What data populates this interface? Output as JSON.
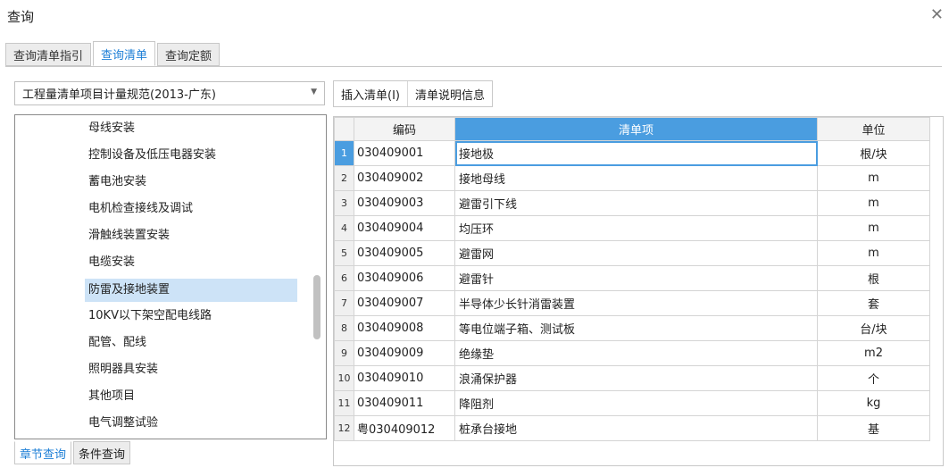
{
  "window": {
    "title": "查询",
    "close_glyph": "✕"
  },
  "tabs": [
    {
      "label": "查询清单指引"
    },
    {
      "label": "查询清单"
    },
    {
      "label": "查询定额"
    }
  ],
  "standard_select": {
    "value": "工程量清单项目计量规范(2013-广东)"
  },
  "toolbar": {
    "insert_label": "插入清单(I)",
    "info_label": "清单说明信息"
  },
  "tree": {
    "items": [
      {
        "label": "母线安装"
      },
      {
        "label": "控制设备及低压电器安装"
      },
      {
        "label": "蓄电池安装"
      },
      {
        "label": "电机检查接线及调试"
      },
      {
        "label": "滑触线装置安装"
      },
      {
        "label": "电缆安装"
      },
      {
        "label": "防雷及接地装置"
      },
      {
        "label": "10KV以下架空配电线路"
      },
      {
        "label": "配管、配线"
      },
      {
        "label": "照明器具安装"
      },
      {
        "label": "其他项目"
      },
      {
        "label": "电气调整试验"
      }
    ],
    "selected_index": 6
  },
  "bottom_tabs": [
    {
      "label": "章节查询"
    },
    {
      "label": "条件查询"
    }
  ],
  "grid": {
    "headers": {
      "code": "编码",
      "name": "清单项",
      "unit": "单位"
    },
    "rows": [
      {
        "no": "1",
        "code": "030409001",
        "name": "接地极",
        "unit": "根/块"
      },
      {
        "no": "2",
        "code": "030409002",
        "name": "接地母线",
        "unit": "m"
      },
      {
        "no": "3",
        "code": "030409003",
        "name": "避雷引下线",
        "unit": "m"
      },
      {
        "no": "4",
        "code": "030409004",
        "name": "均压环",
        "unit": "m"
      },
      {
        "no": "5",
        "code": "030409005",
        "name": "避雷网",
        "unit": "m"
      },
      {
        "no": "6",
        "code": "030409006",
        "name": "避雷针",
        "unit": "根"
      },
      {
        "no": "7",
        "code": "030409007",
        "name": "半导体少长针消雷装置",
        "unit": "套"
      },
      {
        "no": "8",
        "code": "030409008",
        "name": "等电位端子箱、测试板",
        "unit": "台/块"
      },
      {
        "no": "9",
        "code": "030409009",
        "name": "绝缘垫",
        "unit": "m2"
      },
      {
        "no": "10",
        "code": "030409010",
        "name": "浪涌保护器",
        "unit": "个"
      },
      {
        "no": "11",
        "code": "030409011",
        "name": "降阻剂",
        "unit": "kg"
      },
      {
        "no": "12",
        "code": "粤030409012",
        "name": "桩承台接地",
        "unit": "基"
      }
    ]
  }
}
